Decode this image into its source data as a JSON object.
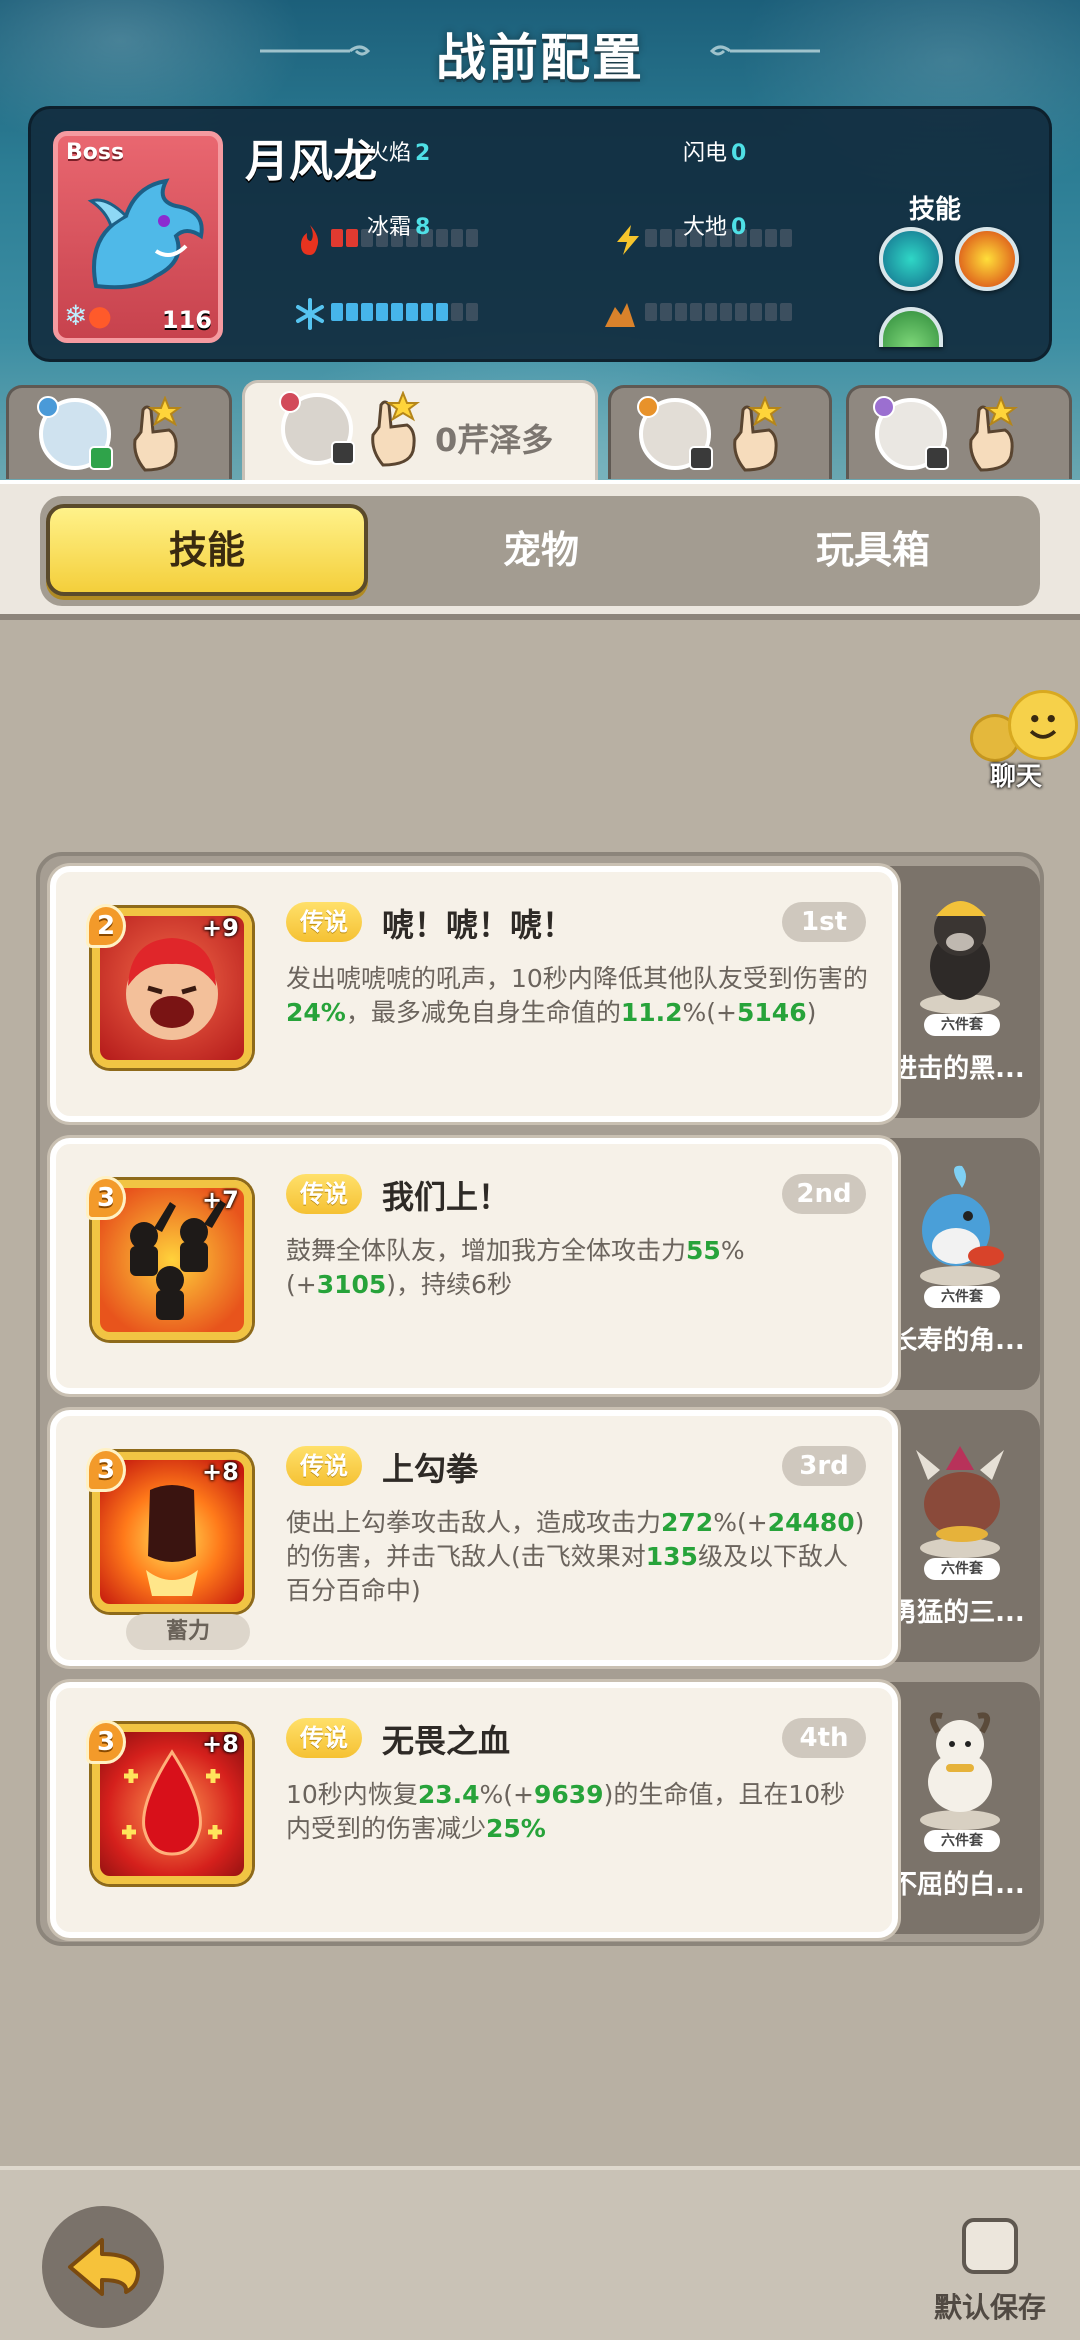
{
  "header": {
    "title": "战前配置"
  },
  "boss": {
    "tag": "Boss",
    "name": "月风龙",
    "level": "116",
    "stats": [
      {
        "label": "火焰",
        "value": "2",
        "filled": 2,
        "total": 10,
        "icon": "fire-icon"
      },
      {
        "label": "闪电",
        "value": "0",
        "filled": 0,
        "total": 10,
        "icon": "lightning-icon"
      },
      {
        "label": "冰霜",
        "value": "8",
        "filled": 8,
        "total": 10,
        "icon": "snowflake-icon"
      },
      {
        "label": "大地",
        "value": "0",
        "filled": 0,
        "total": 10,
        "icon": "earth-icon"
      }
    ],
    "skills_label": "技能"
  },
  "character_tabs": [
    {
      "name": "",
      "active": false
    },
    {
      "name": "0芹泽多",
      "active": true
    },
    {
      "name": "",
      "active": false
    },
    {
      "name": "",
      "active": false
    }
  ],
  "category_tabs": [
    {
      "label": "技能",
      "active": true
    },
    {
      "label": "宠物",
      "active": false
    },
    {
      "label": "玩具箱",
      "active": false
    }
  ],
  "chat": {
    "label": "聊天"
  },
  "skills": [
    {
      "level": "2",
      "plus": "+9",
      "rarity": "传说",
      "name": "唬！唬！唬！",
      "rank": "1st",
      "desc_parts": [
        "发出唬唬唬的吼声，10秒内降低其他队友受到伤害的",
        "24%",
        "，最多减免自身生命值的",
        "11.2",
        "%(+",
        "5146",
        ")"
      ],
      "icon": "roar-icon",
      "pet": {
        "set": "六件套",
        "name": "进击的黑..."
      }
    },
    {
      "level": "3",
      "plus": "+7",
      "rarity": "传说",
      "name": "我们上！",
      "rank": "2nd",
      "desc_parts": [
        "鼓舞全体队友，增加我方全体攻击力",
        "55",
        "%(+",
        "3105",
        ")，持续6秒"
      ],
      "icon": "charge-crowd-icon",
      "pet": {
        "set": "六件套",
        "name": "长寿的角..."
      }
    },
    {
      "level": "3",
      "plus": "+8",
      "rarity": "传说",
      "name": "上勾拳",
      "rank": "3rd",
      "charge_tag": "蓄力",
      "desc_parts": [
        "使出上勾拳攻击敌人，造成攻击力",
        "272",
        "%(+",
        "24480",
        ")的伤害，并击飞敌人(击飞效果对",
        "135",
        "级及以下敌人百分百命中)"
      ],
      "icon": "uppercut-fist-icon",
      "pet": {
        "set": "六件套",
        "name": "勇猛的三..."
      }
    },
    {
      "level": "3",
      "plus": "+8",
      "rarity": "传说",
      "name": "无畏之血",
      "rank": "4th",
      "desc_parts": [
        "10秒内恢复",
        "23.4",
        "%(+",
        "9639",
        ")的生命值，且在10秒内受到的伤害减少",
        "25%",
        ""
      ],
      "icon": "blood-drop-icon",
      "pet": {
        "set": "六件套",
        "name": "不屈的白..."
      }
    }
  ],
  "footer": {
    "default_save_label": "默认保存"
  }
}
